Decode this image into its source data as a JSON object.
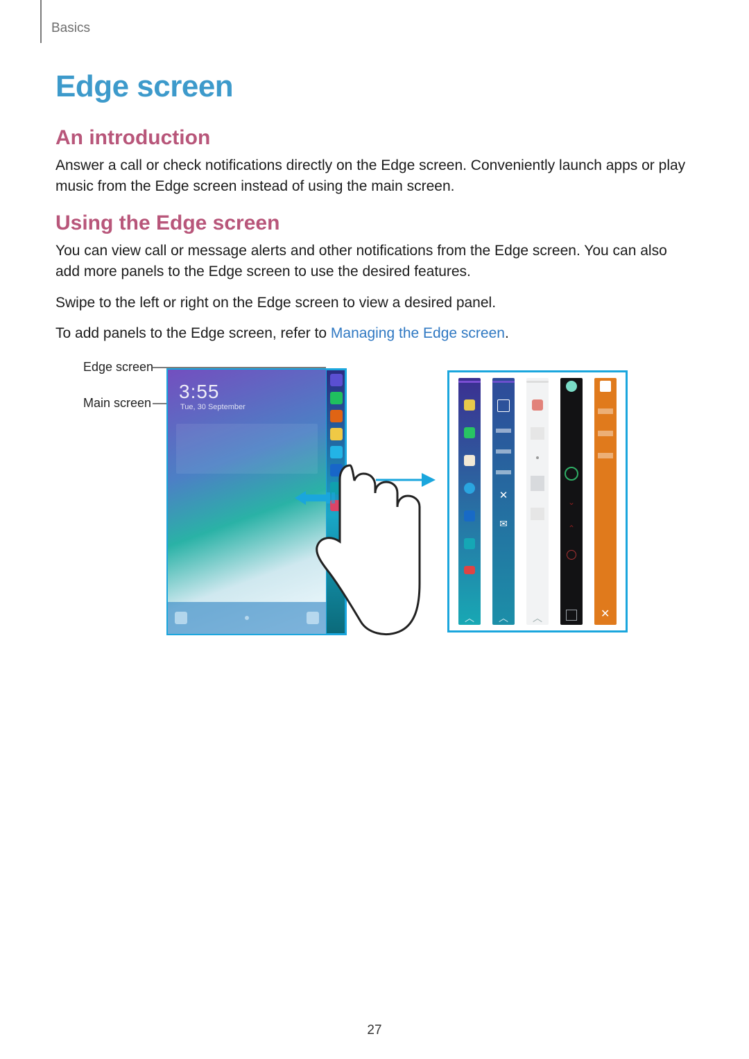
{
  "breadcrumb": "Basics",
  "h1": "Edge screen",
  "sections": {
    "intro": {
      "heading": "An introduction",
      "body": "Answer a call or check notifications directly on the Edge screen. Conveniently launch apps or play music from the Edge screen instead of using the main screen."
    },
    "using": {
      "heading": "Using the Edge screen",
      "p1": "You can view call or message alerts and other notifications from the Edge screen. You can also add more panels to the Edge screen to use the desired features.",
      "p2": "Swipe to the left or right on the Edge screen to view a desired panel.",
      "p3_prefix": "To add panels to the Edge screen, refer to ",
      "p3_link": "Managing the Edge screen",
      "p3_suffix": "."
    }
  },
  "figure": {
    "callout_edge": "Edge screen",
    "callout_main": "Main screen",
    "edge_icons": [
      "star",
      "phone",
      "contact",
      "mail",
      "browser",
      "camera",
      "gallery",
      "apps"
    ],
    "panel_variants": [
      "favorites",
      "tasks",
      "briefing",
      "music",
      "messaging"
    ]
  },
  "page_number": "27",
  "colors": {
    "heading_blue": "#3d9acb",
    "heading_pink": "#b8567a",
    "link_blue": "#2f78c2",
    "frame_cyan": "#1aa6dd"
  }
}
